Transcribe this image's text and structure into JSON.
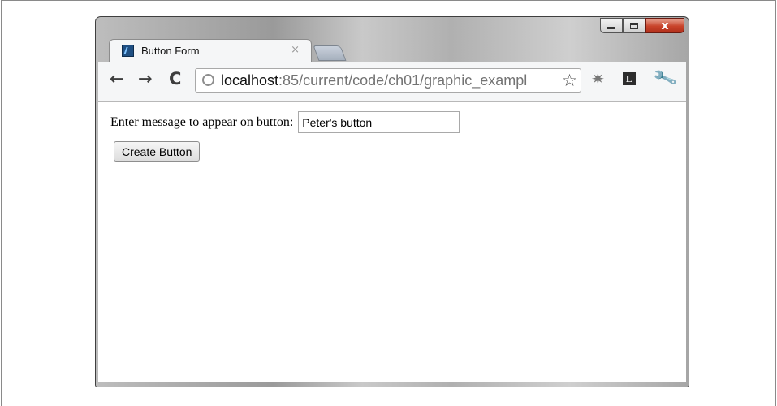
{
  "window": {
    "tab_title": "Button Form",
    "tab_close": "×",
    "controls": {
      "minimize": "minimize",
      "maximize": "maximize",
      "close": "x"
    }
  },
  "toolbar": {
    "back": "←",
    "forward": "→",
    "reload": "C",
    "url_host": "localhost",
    "url_path": ":85/current/code/ch01/graphic_exampl",
    "bookmark": "☆",
    "extension_gear": "✷",
    "extension_l": "L",
    "wrench": "🔧"
  },
  "page": {
    "prompt_label": "Enter message to appear on button:",
    "message_value": "Peter's button",
    "create_button_label": "Create Button"
  },
  "icons": [
    "app-icon",
    "globe-icon",
    "star-icon",
    "gear-icon",
    "l-icon",
    "wrench-icon",
    "close-icon"
  ]
}
